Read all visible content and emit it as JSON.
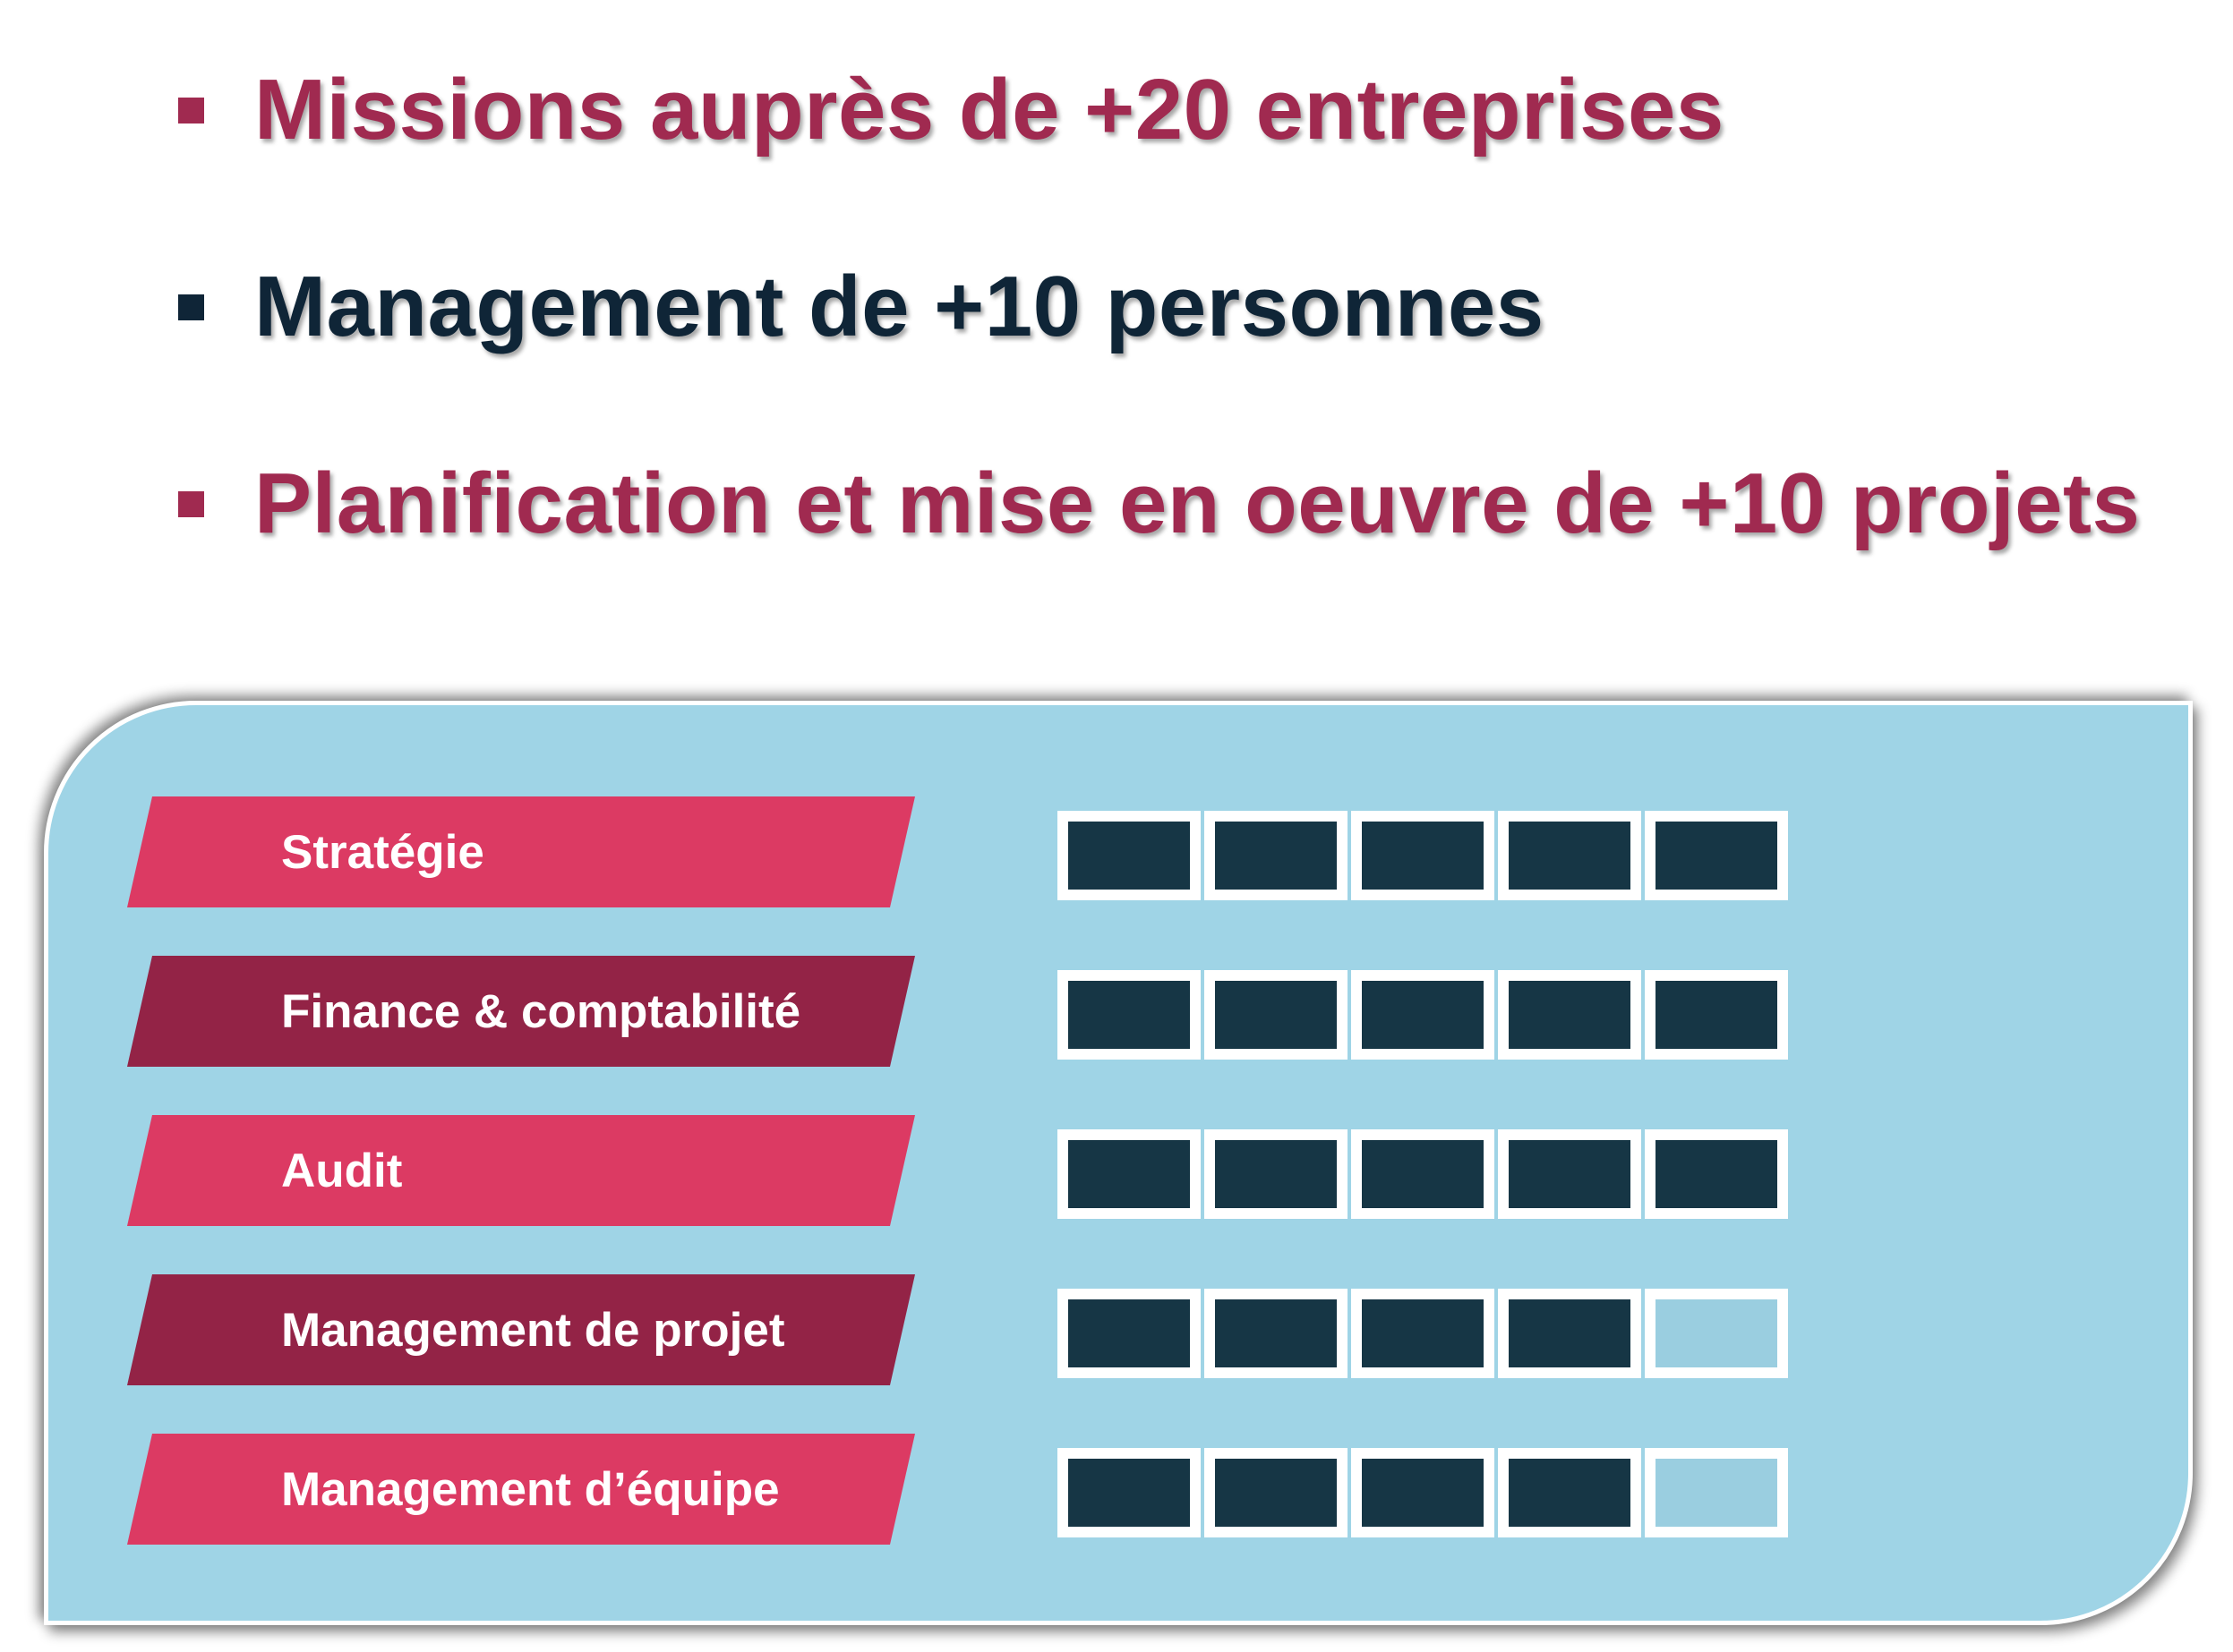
{
  "colors": {
    "accent_red": "#a02a50",
    "navy": "#0f2537",
    "label_pink": "#dc3a63",
    "label_maroon": "#932346",
    "panel_bg": "#9fd4e6",
    "box_filled": "#163645",
    "box_empty": "#9acee0"
  },
  "highlights": [
    {
      "text": "Missions auprès de +20 entreprises",
      "color": "#a02a50"
    },
    {
      "text": "Management de +10 personnes",
      "color": "#0f2537"
    },
    {
      "text": "Planification et mise en oeuvre de +10 projets",
      "color": "#a02a50"
    }
  ],
  "skills": [
    {
      "label": "Stratégie",
      "color": "#dc3a63",
      "level": 5,
      "max": 5
    },
    {
      "label": "Finance & comptabilité",
      "color": "#932346",
      "level": 5,
      "max": 5
    },
    {
      "label": "Audit",
      "color": "#dc3a63",
      "level": 5,
      "max": 5
    },
    {
      "label": "Management de projet",
      "color": "#932346",
      "level": 4,
      "max": 5
    },
    {
      "label": "Management d’équipe",
      "color": "#dc3a63",
      "level": 4,
      "max": 5
    }
  ]
}
